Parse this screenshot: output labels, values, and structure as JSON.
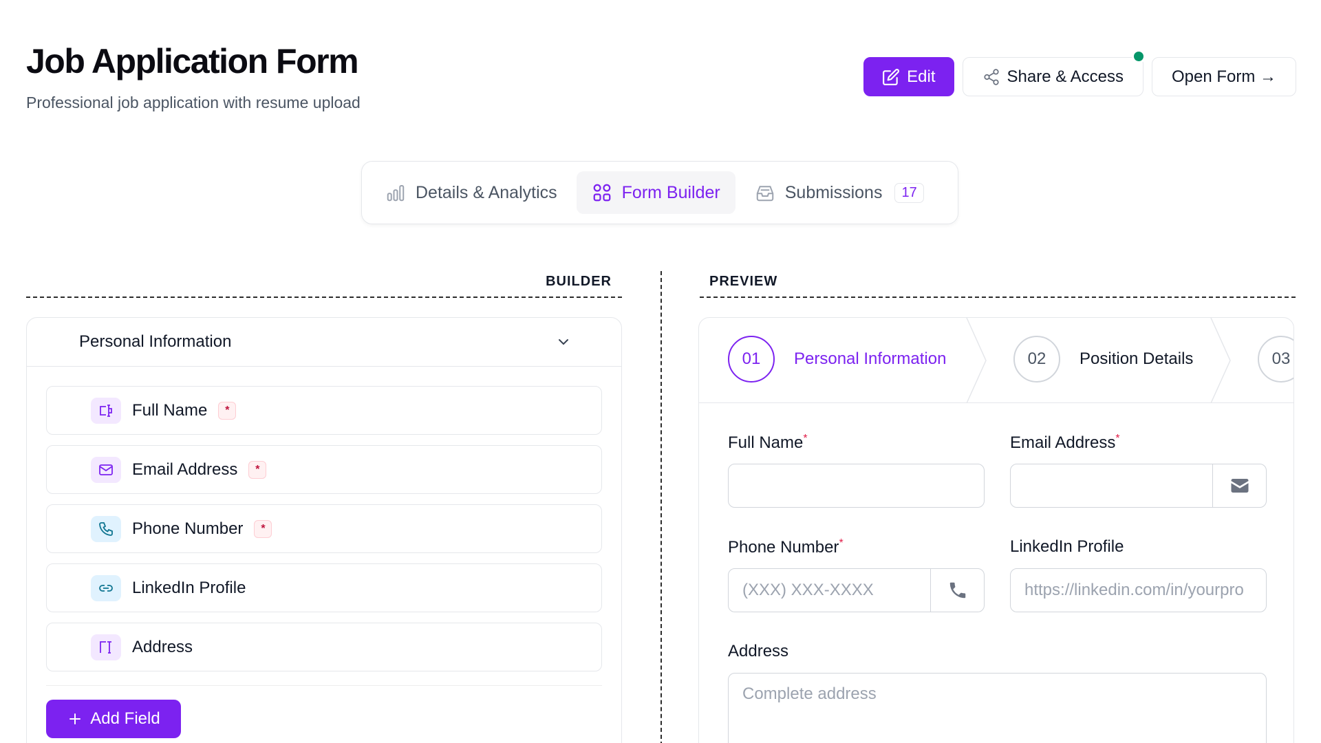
{
  "header": {
    "title": "Job Application Form",
    "subtitle": "Professional job application with resume upload",
    "edit_label": "Edit",
    "share_label": "Share & Access",
    "open_label": "Open Form →"
  },
  "tabs": [
    {
      "label": "Details & Analytics",
      "icon": "bar-chart-icon"
    },
    {
      "label": "Form Builder",
      "icon": "grid-icon",
      "active": true
    },
    {
      "label": "Submissions",
      "icon": "inbox-icon",
      "count": "17"
    }
  ],
  "builder": {
    "heading": "BUILDER",
    "section_title": "Personal Information",
    "fields": [
      {
        "label": "Full Name",
        "icon": "text-input-icon",
        "required": "*"
      },
      {
        "label": "Email Address",
        "icon": "mail-icon",
        "required": "*"
      },
      {
        "label": "Phone Number",
        "icon": "phone-icon",
        "required": "*"
      },
      {
        "label": "LinkedIn Profile",
        "icon": "link-icon"
      },
      {
        "label": "Address",
        "icon": "text-area-icon"
      }
    ],
    "add_field_label": "Add Field"
  },
  "preview": {
    "heading": "PREVIEW",
    "steps": [
      {
        "num": "01",
        "label": "Personal Information",
        "active": true
      },
      {
        "num": "02",
        "label": "Position Details"
      },
      {
        "num": "03",
        "label": ""
      }
    ],
    "fields": {
      "full_name": {
        "label": "Full Name",
        "required": "*",
        "value": ""
      },
      "email": {
        "label": "Email Address",
        "required": "*",
        "value": ""
      },
      "phone": {
        "label": "Phone Number",
        "required": "*",
        "placeholder": "(XXX) XXX-XXXX"
      },
      "linkedin": {
        "label": "LinkedIn Profile",
        "placeholder": "https://linkedin.com/in/yourpro"
      },
      "address": {
        "label": "Address",
        "placeholder": "Complete address"
      }
    }
  },
  "colors": {
    "accent": "#7c22f0",
    "online_dot": "#059669",
    "required": "#e11d48"
  }
}
